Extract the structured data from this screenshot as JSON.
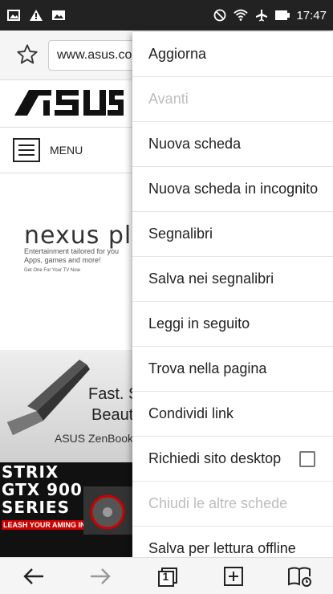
{
  "status_bar": {
    "time": "17:47",
    "left_icons": [
      "gallery-notification-icon",
      "warning-icon",
      "image-notification-icon"
    ],
    "right_icons": [
      "do-not-disturb-icon",
      "wifi-icon",
      "airplane-mode-icon",
      "battery-icon"
    ]
  },
  "browser": {
    "url": "www.asus.co",
    "bookmark_icon": "star-icon"
  },
  "page": {
    "logo_text": "/ISUS",
    "menu_label": "MENU",
    "nexus": {
      "title": "nexus playe",
      "subtitle": "Entertainment tailored for you Apps, games and more!",
      "small": "Get One For Your TV Now"
    },
    "zenbook": {
      "line1": "Fast. S",
      "line2": "Beauti",
      "brand": "ASUS ZenBook"
    },
    "strix": {
      "lines": [
        "STRIX",
        "GTX 900",
        "SERIES"
      ],
      "tagline": "LEASH YOUR AMING INSTINCTS"
    }
  },
  "overflow_menu": {
    "items": [
      {
        "label": "Aggiorna",
        "enabled": true
      },
      {
        "label": "Avanti",
        "enabled": false
      },
      {
        "label": "Nuova scheda",
        "enabled": true
      },
      {
        "label": "Nuova scheda in incognito",
        "enabled": true
      },
      {
        "label": "Segnalibri",
        "enabled": true
      },
      {
        "label": "Salva nei segnalibri",
        "enabled": true
      },
      {
        "label": "Leggi in seguito",
        "enabled": true
      },
      {
        "label": "Trova nella pagina",
        "enabled": true
      },
      {
        "label": "Condividi link",
        "enabled": true
      },
      {
        "label": "Richiedi sito desktop",
        "enabled": true,
        "checkbox": false
      },
      {
        "label": "Chiudi le altre schede",
        "enabled": false
      },
      {
        "label": "Salva per lettura offline",
        "enabled": true
      }
    ]
  },
  "bottom_bar": {
    "buttons": [
      "back-arrow-icon",
      "forward-arrow-icon",
      "tabs-icon",
      "new-tab-icon",
      "bookmarks-icon"
    ],
    "tab_count": "1"
  }
}
